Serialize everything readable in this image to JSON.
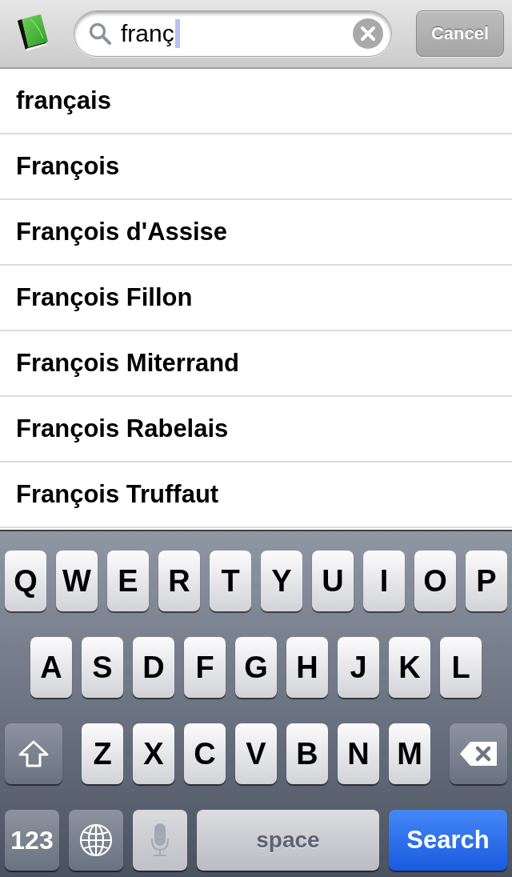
{
  "search_bar": {
    "value": "franç",
    "cancel_label": "Cancel"
  },
  "suggestions": [
    "français",
    "François",
    "François d'Assise",
    "François Fillon",
    "François Miterrand",
    "François Rabelais",
    "François Truffaut"
  ],
  "keyboard": {
    "letter_rows": [
      [
        "Q",
        "W",
        "E",
        "R",
        "T",
        "Y",
        "U",
        "I",
        "O",
        "P"
      ],
      [
        "A",
        "S",
        "D",
        "F",
        "G",
        "H",
        "J",
        "K",
        "L"
      ],
      [
        "Z",
        "X",
        "C",
        "V",
        "B",
        "N",
        "M"
      ]
    ],
    "bottom_row": [
      {
        "kind": "numbers",
        "label": "123",
        "disabled": false
      },
      {
        "kind": "globe",
        "disabled": false
      },
      {
        "kind": "mic",
        "disabled": true
      },
      {
        "kind": "space",
        "label": "space",
        "disabled": false
      },
      {
        "kind": "search",
        "label": "Search",
        "disabled": false
      }
    ]
  }
}
